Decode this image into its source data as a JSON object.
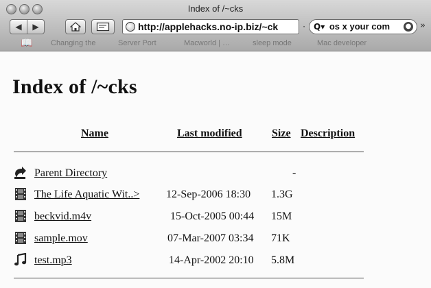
{
  "browser": {
    "window_title": "Index of /~cks",
    "url": "http://applehacks.no-ip.biz/~ck",
    "search_query": "os x your com",
    "bookmarks": [
      "Changing the",
      "Server Port",
      "Macworld | …",
      "sleep mode",
      "Mac developer"
    ]
  },
  "page": {
    "heading": "Index of /~cks",
    "columns": {
      "name": "Name",
      "last_modified": "Last modified",
      "size": "Size",
      "description": "Description"
    },
    "rows": [
      {
        "icon": "parent-directory-icon",
        "name": "Parent Directory",
        "date": "",
        "size": "-"
      },
      {
        "icon": "movie-file-icon",
        "name": "The Life Aquatic Wit..>",
        "date": "12-Sep-2006 18:30",
        "size": "1.3G"
      },
      {
        "icon": "movie-file-icon",
        "name": "beckvid.m4v",
        "date": "15-Oct-2005 00:44",
        "size": "15M"
      },
      {
        "icon": "movie-file-icon",
        "name": "sample.mov",
        "date": "07-Mar-2007 03:34",
        "size": "71K"
      },
      {
        "icon": "audio-file-icon",
        "name": "test.mp3",
        "date": "14-Apr-2002 20:10",
        "size": "5.8M"
      }
    ]
  }
}
